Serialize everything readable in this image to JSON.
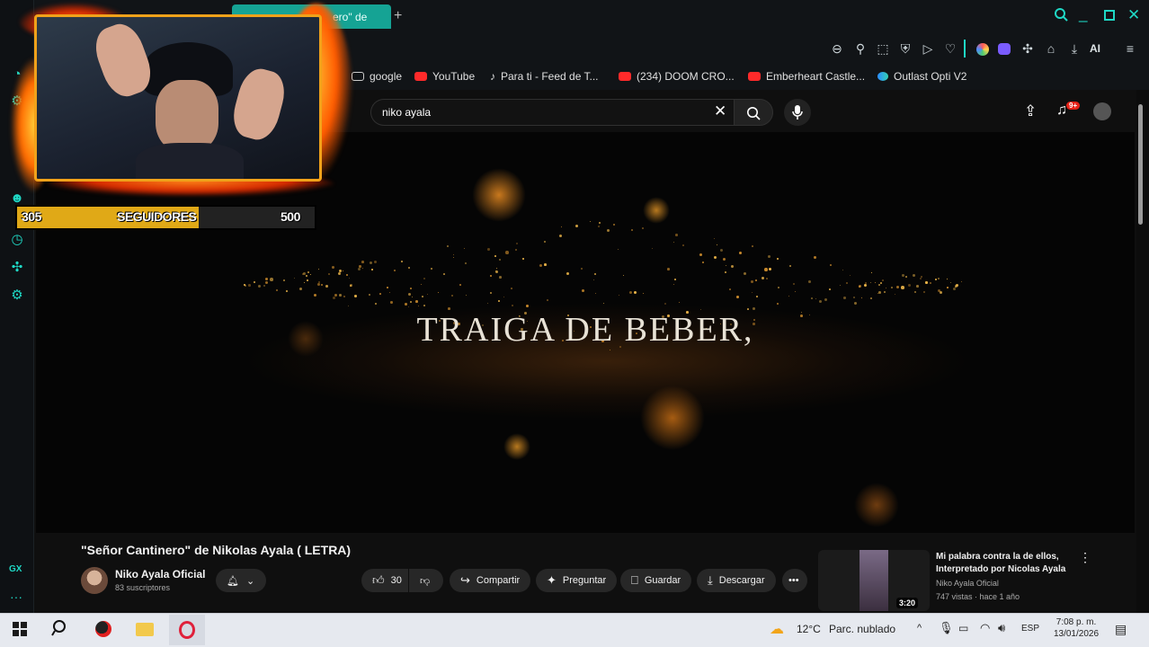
{
  "browser": {
    "tab_title": "ero\" de",
    "bookmarks": [
      {
        "label": "google",
        "icon": "folder-icon"
      },
      {
        "label": "YouTube",
        "icon": "youtube-icon"
      },
      {
        "label": "Para ti - Feed de T...",
        "icon": "tiktok-icon"
      },
      {
        "label": "(234) DOOM CRO...",
        "icon": "youtube-icon"
      },
      {
        "label": "Emberheart Castle...",
        "icon": "youtube-icon"
      },
      {
        "label": "Outlast Opti V2",
        "icon": "edge-icon"
      }
    ],
    "toolbar_ai_label": "AI",
    "sidebar_gx_label": "GX",
    "accent": "#1fd8c5"
  },
  "youtube": {
    "search_query": "niko ayala",
    "notification_count": "9+",
    "video_lyric": "TRAIGA DE BEBER,",
    "video_title": "\"Señor Cantinero\" de Nikolas Ayala ( LETRA)",
    "channel_name": "Niko Ayala Oficial",
    "subscribers": "83 suscriptores",
    "like_count": "30",
    "actions": {
      "share": "Compartir",
      "ask": "Preguntar",
      "save": "Guardar",
      "download": "Descargar"
    },
    "related": {
      "title": "Mi palabra contra la de ellos, Interpretado por Nicolas Ayala",
      "channel": "Niko Ayala Oficial",
      "meta": "747 vistas · hace 1 año",
      "duration": "3:20"
    }
  },
  "stream_overlay": {
    "followers_current": "305",
    "followers_label": "SEGUIDORES",
    "followers_goal": "500",
    "progress_fraction": 0.61
  },
  "taskbar": {
    "weather_temp": "12°C",
    "weather_desc": "Parc. nublado",
    "language": "ESP",
    "time": "7:08 p. m.",
    "date": "13/01/2026"
  }
}
